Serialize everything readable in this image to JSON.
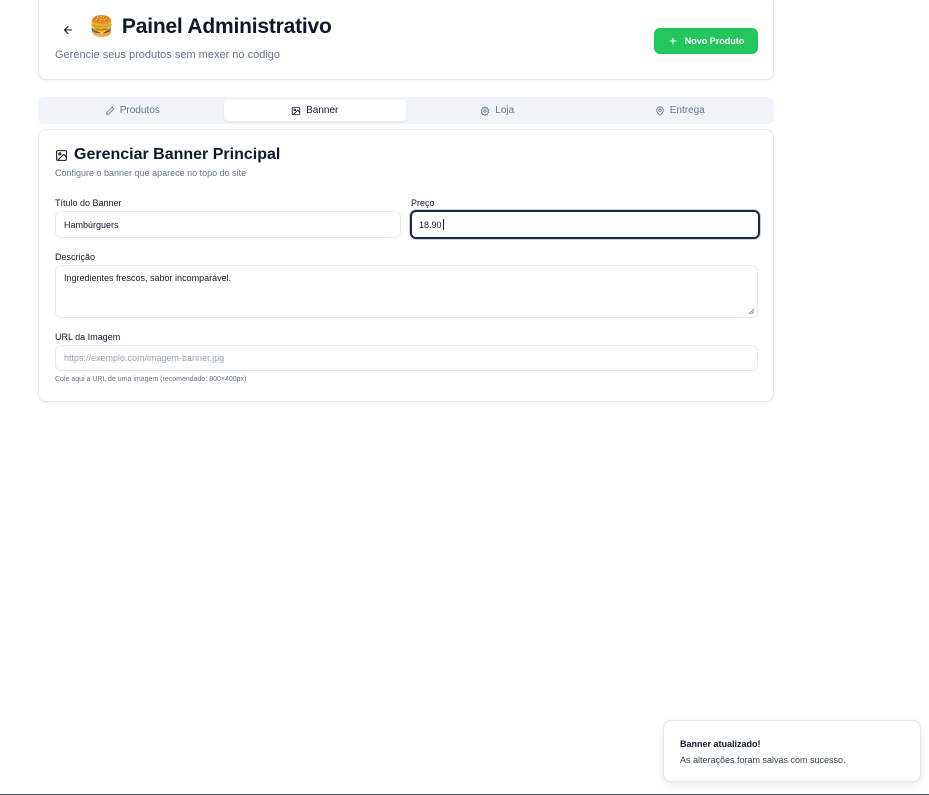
{
  "header": {
    "emoji": "🍔",
    "title": "Painel Administrativo",
    "subtitle": "Gerencie seus produtos sem mexer no código",
    "new_product_label": "Novo Produto"
  },
  "tabs": [
    {
      "label": "Produtos",
      "icon": "pencil-icon",
      "active": false
    },
    {
      "label": "Banner",
      "icon": "image-icon",
      "active": true
    },
    {
      "label": "Loja",
      "icon": "gear-icon",
      "active": false
    },
    {
      "label": "Entrega",
      "icon": "map-pin-icon",
      "active": false
    }
  ],
  "banner": {
    "title": "Gerenciar Banner Principal",
    "description": "Configure o banner que aparece no topo do site",
    "fields": {
      "title_label": "Título do Banner",
      "title_value": "Hambúrguers",
      "price_label": "Preço",
      "price_value": "18.90",
      "description_label": "Descrição",
      "description_value": "Ingredientes frescos, sabor incomparável.",
      "image_url_label": "URL da Imagem",
      "image_url_placeholder": "https://exemplo.com/imagem-banner.jpg",
      "image_url_hint": "Cole aqui a URL de uma imagem (recomendado: 800×400px)"
    }
  },
  "toast": {
    "title": "Banner atualizado!",
    "message": "As alterações foram salvas com sucesso."
  },
  "colors": {
    "accent_green": "#22c55e",
    "text_primary": "#0f172a",
    "text_muted": "#64748b",
    "border": "#e2e8f0",
    "tab_bg": "#f1f5f9"
  }
}
